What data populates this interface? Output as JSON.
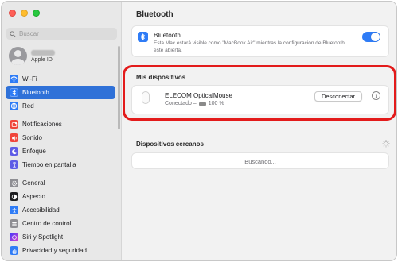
{
  "window": {
    "title": "Bluetooth"
  },
  "sidebar": {
    "search_placeholder": "Buscar",
    "account": {
      "subtitle": "Apple ID"
    },
    "group1": [
      {
        "label": "Wi-Fi",
        "icon": "wifi-icon",
        "color": "#2f7cf6",
        "selected": false
      },
      {
        "label": "Bluetooth",
        "icon": "bluetooth-icon",
        "color": "#2f7cf6",
        "selected": true
      },
      {
        "label": "Red",
        "icon": "network-icon",
        "color": "#2f7cf6",
        "selected": false
      }
    ],
    "group2": [
      {
        "label": "Notificaciones",
        "icon": "notifications-icon",
        "color": "#f0443a"
      },
      {
        "label": "Sonido",
        "icon": "sound-icon",
        "color": "#f0443a"
      },
      {
        "label": "Enfoque",
        "icon": "focus-moon-icon",
        "color": "#5e5ce6"
      },
      {
        "label": "Tiempo en pantalla",
        "icon": "screen-time-icon",
        "color": "#5e5ce6"
      }
    ],
    "group3": [
      {
        "label": "General",
        "icon": "gear-icon",
        "color": "#8e8e93"
      },
      {
        "label": "Aspecto",
        "icon": "appearance-icon",
        "color": "#1d1d1f"
      },
      {
        "label": "Accesibilidad",
        "icon": "accessibility-icon",
        "color": "#2f7cf6"
      },
      {
        "label": "Centro de control",
        "icon": "control-center-icon",
        "color": "#8e8e93"
      },
      {
        "label": "Siri y Spotlight",
        "icon": "siri-icon",
        "color": "#b04fe0"
      },
      {
        "label": "Privacidad y seguridad",
        "icon": "privacy-hand-icon",
        "color": "#2f7cf6"
      }
    ]
  },
  "main": {
    "title": "Bluetooth",
    "bluetooth_card": {
      "name": "Bluetooth",
      "description": "Esta Mac estará visible como \"MacBook Air\" mientras la configuración de Bluetooth esté abierta.",
      "toggle_on": true
    },
    "my_devices": {
      "title": "Mis dispositivos",
      "device_name": "ELECOM OpticalMouse",
      "status_prefix": "Conectado –",
      "battery": "100 %",
      "disconnect_label": "Desconectar"
    },
    "nearby": {
      "title": "Dispositivos cercanos",
      "searching": "Buscando..."
    }
  },
  "accent": {
    "selection": "#2f71d8",
    "highlight": "#e31b1b",
    "toggle": "#2f7cf6"
  }
}
